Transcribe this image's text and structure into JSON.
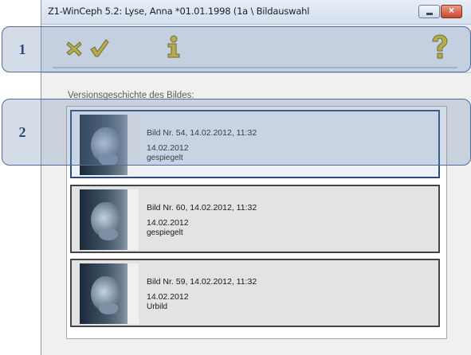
{
  "window": {
    "title": "Z1-WinCeph 5.2: Lyse, Anna *01.01.1998 (1a \\ Bildauswahl",
    "minimize_label": "",
    "close_label": "×"
  },
  "toolbar": {
    "icons": [
      "cancel-icon",
      "ok-checkmark-icon",
      "info-icon",
      "help-icon"
    ],
    "accent": "#d7c020"
  },
  "main": {
    "section_label": "Versionsgeschichte des Bildes:",
    "entries": [
      {
        "title": "Bild Nr. 54, 14.02.2012, 11:32",
        "date": "14.02.2012",
        "status": "gespiegelt",
        "selected": true
      },
      {
        "title": "Bild Nr. 60, 14.02.2012, 11:32",
        "date": "14.02.2012",
        "status": "gespiegelt",
        "selected": false
      },
      {
        "title": "Bild Nr. 59, 14.02.2012, 11:32",
        "date": "14.02.2012",
        "status": "Urbild",
        "selected": false
      }
    ]
  },
  "callouts": [
    "1",
    "2"
  ],
  "colors": {
    "callout_fill": "#708cb2",
    "callout_text": "#2c4a78",
    "title_bg": "#dbe5f1"
  }
}
